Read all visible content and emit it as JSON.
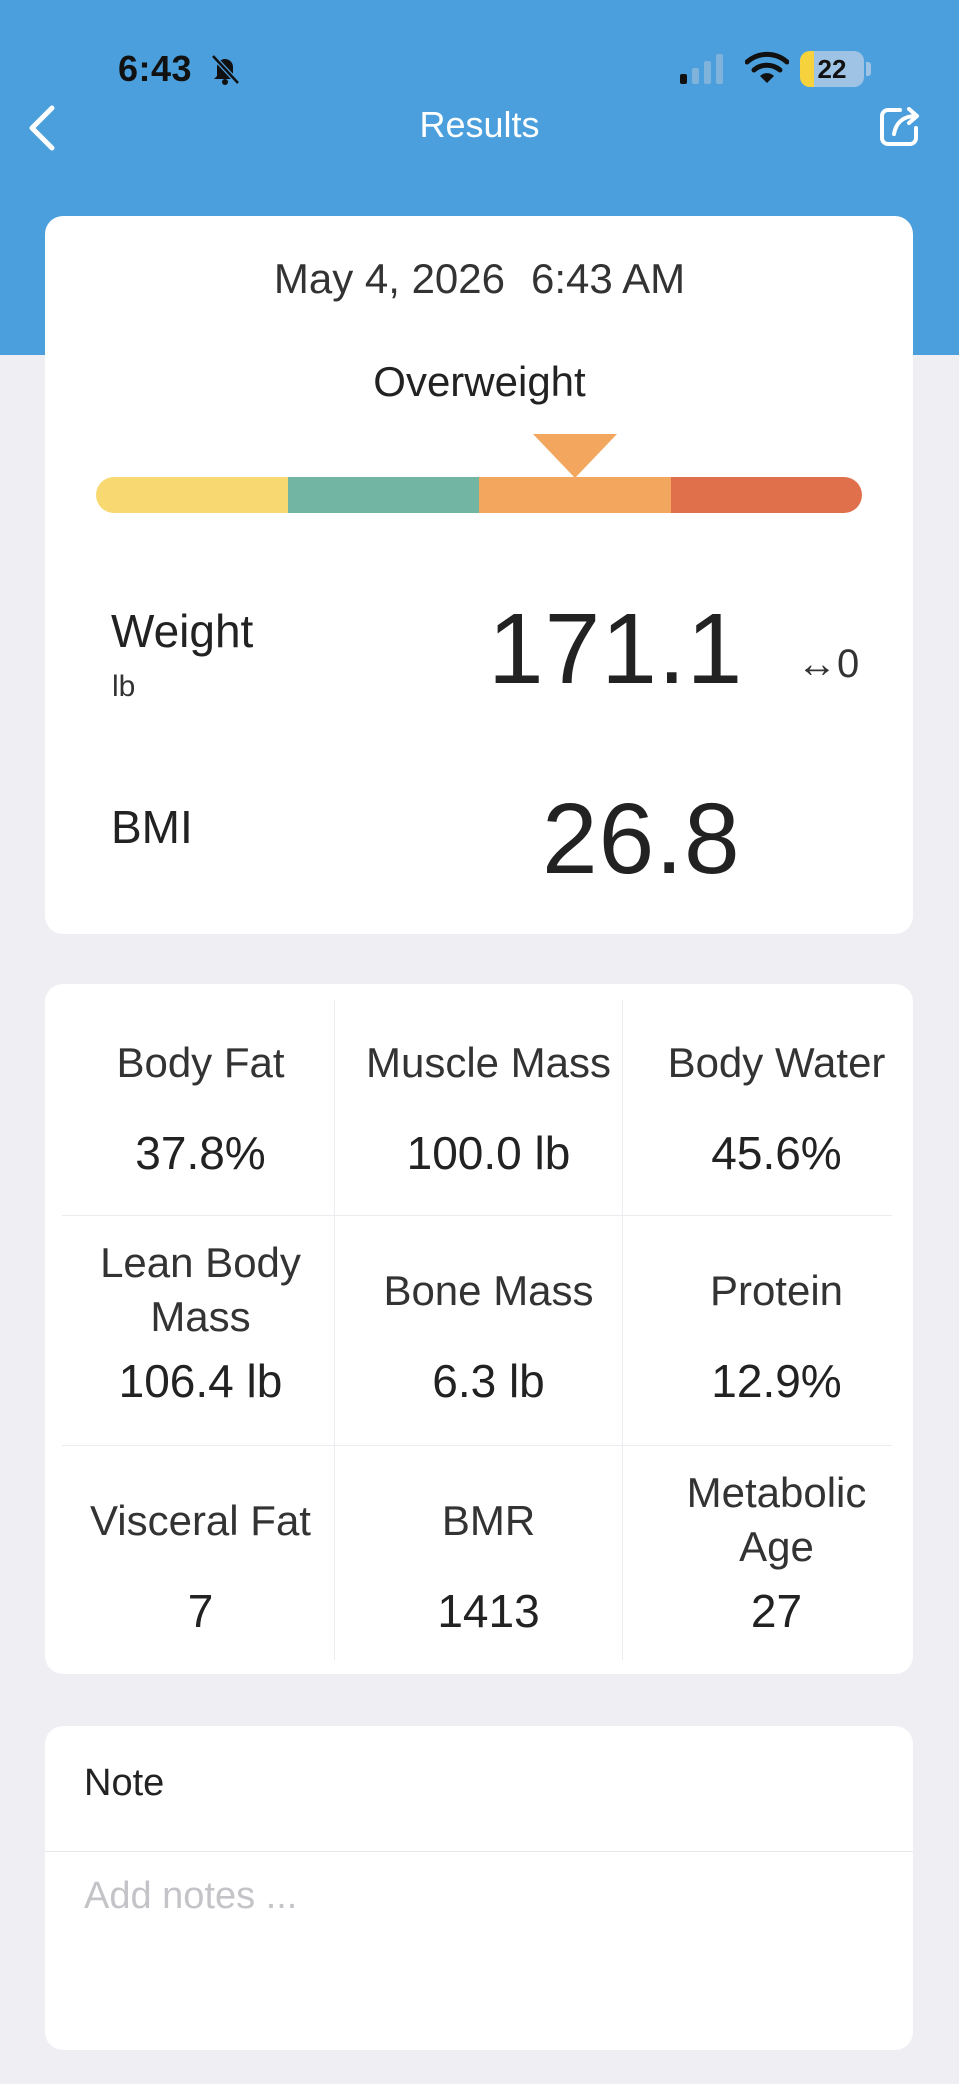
{
  "status_bar": {
    "time": "6:43",
    "icons": [
      "bell-slash-icon",
      "cellular-signal-icon",
      "wifi-icon",
      "battery-icon"
    ],
    "battery_level": "22"
  },
  "nav": {
    "title": "Results",
    "back_icon": "chevron-left-icon",
    "share_icon": "share-icon"
  },
  "summary": {
    "date": "May 4, 2026",
    "time": "6:43 AM",
    "category": "Overweight",
    "bmi_scale": {
      "colors": [
        "#f8d871",
        "#72b5a3",
        "#f2a65e",
        "#e0704c"
      ],
      "active_segment": 2,
      "pointer_color": "#f2a65e"
    },
    "weight": {
      "label": "Weight",
      "unit": "lb",
      "value": "171.1",
      "change": "↔0"
    },
    "bmi": {
      "label": "BMI",
      "value": "26.8"
    }
  },
  "metrics": [
    {
      "label": "Body Fat",
      "value": "37.8%"
    },
    {
      "label": "Muscle Mass",
      "value": "100.0 lb"
    },
    {
      "label": "Body Water",
      "value": "45.6%"
    },
    {
      "label": "Lean Body Mass",
      "value": "106.4 lb"
    },
    {
      "label": "Bone Mass",
      "value": "6.3 lb"
    },
    {
      "label": "Protein",
      "value": "12.9%"
    },
    {
      "label": "Visceral Fat",
      "value": "7"
    },
    {
      "label": "BMR",
      "value": "1413"
    },
    {
      "label": "Metabolic Age",
      "value": "27"
    }
  ],
  "notes": {
    "title": "Note",
    "placeholder": "Add notes ...",
    "value": ""
  },
  "colors": {
    "header": "#4a9fdc",
    "background": "#efeef3",
    "card": "#ffffff"
  }
}
